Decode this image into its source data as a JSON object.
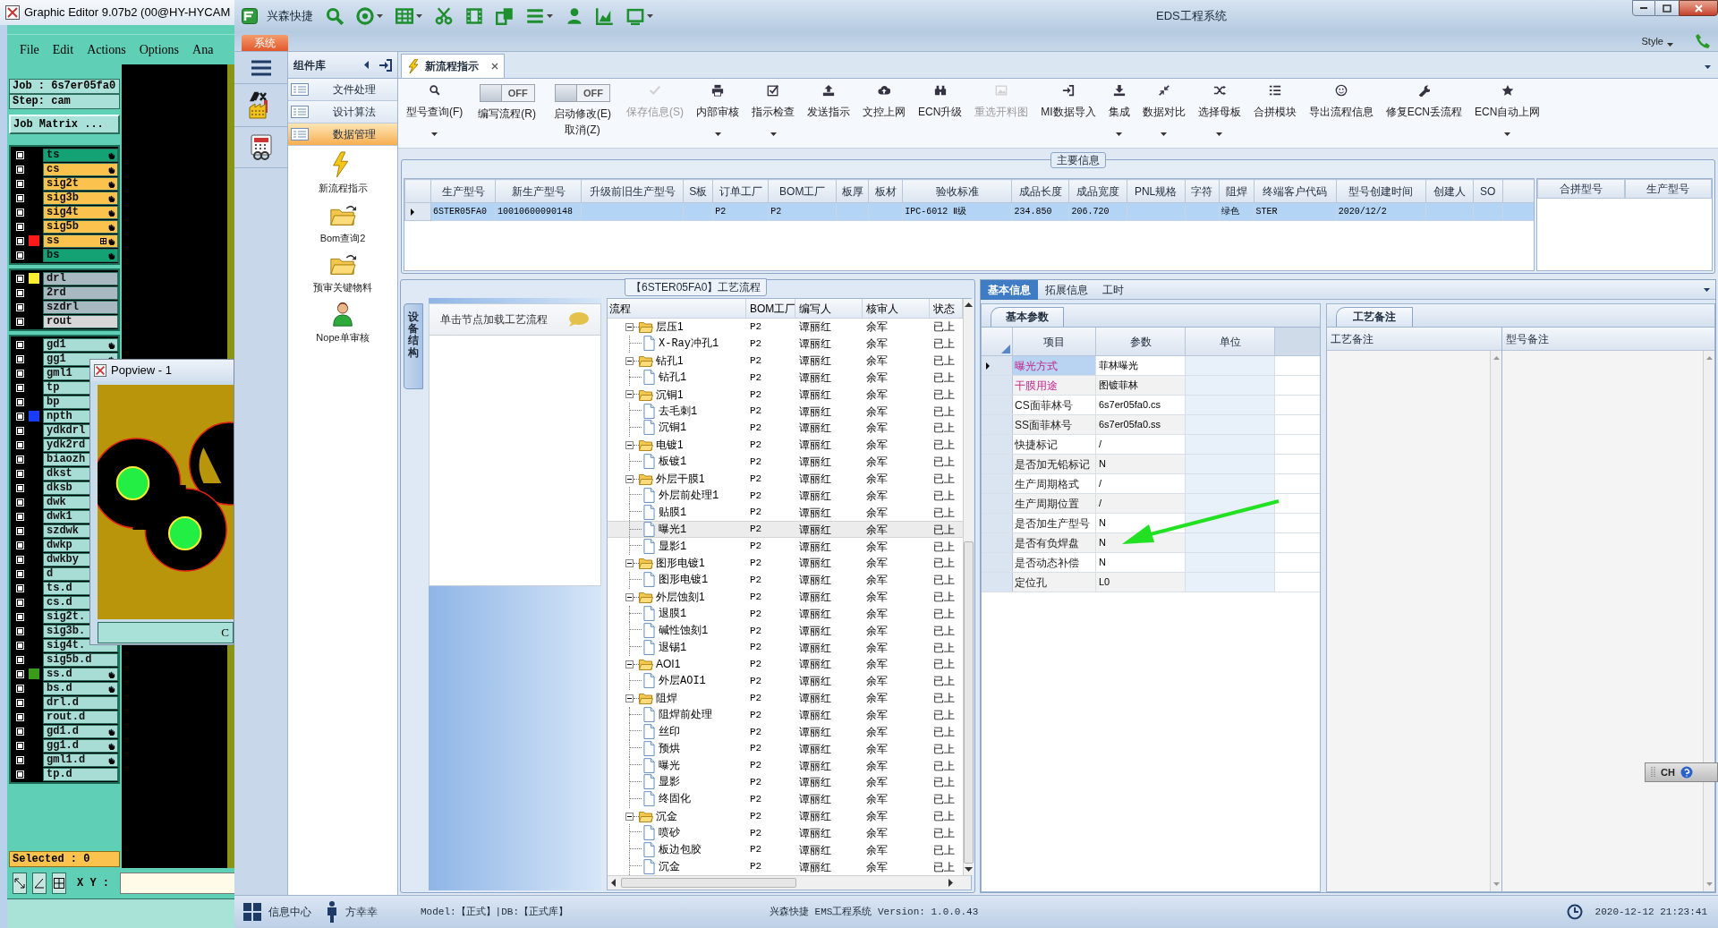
{
  "graphic_editor": {
    "title": "Graphic Editor 9.07b2 (00@HY-HYCAM",
    "menu": [
      "File",
      "Edit",
      "Actions",
      "Options",
      "Ana"
    ],
    "job": "Job : 6s7er05fa0",
    "step": "Step: cam",
    "job_matrix_button": "Job Matrix ...",
    "layer_groups": [
      {
        "layers": [
          {
            "name": "ts",
            "kind": "mask",
            "checked": false,
            "hand": true
          },
          {
            "name": "cs",
            "kind": "signal",
            "checked": false,
            "hand": true
          },
          {
            "name": "sig2t",
            "kind": "signal",
            "checked": false,
            "hand": true
          },
          {
            "name": "sig3b",
            "kind": "signal",
            "checked": false,
            "hand": true
          },
          {
            "name": "sig4t",
            "kind": "signal",
            "checked": false,
            "hand": true
          },
          {
            "name": "sig5b",
            "kind": "signal",
            "checked": false,
            "hand": true
          },
          {
            "name": "ss",
            "kind": "signal",
            "checked": false,
            "hand": true,
            "color": "#ff1a1a",
            "extra_mark": true
          },
          {
            "name": "bs",
            "kind": "mask",
            "checked": false,
            "hand": true
          }
        ]
      },
      {
        "layers": [
          {
            "name": "drl",
            "kind": "drill",
            "checked": false,
            "hand": false,
            "color": "#ffee33"
          },
          {
            "name": "2rd",
            "kind": "drill",
            "checked": false,
            "hand": false
          },
          {
            "name": "szdrl",
            "kind": "drill",
            "checked": false,
            "hand": false
          },
          {
            "name": "rout",
            "kind": "rout",
            "checked": false,
            "hand": false
          }
        ]
      },
      {
        "layers": [
          {
            "name": "gd1",
            "kind": "misc",
            "checked": false,
            "hand": true
          },
          {
            "name": "gg1",
            "kind": "misc",
            "checked": false,
            "hand": true
          },
          {
            "name": "gml1",
            "kind": "misc",
            "checked": false,
            "hand": false
          },
          {
            "name": "tp",
            "kind": "misc",
            "checked": false,
            "hand": false
          },
          {
            "name": "bp",
            "kind": "misc",
            "checked": false,
            "hand": false
          },
          {
            "name": "npth",
            "kind": "misc",
            "checked": false,
            "hand": false,
            "color": "#1a3cff"
          },
          {
            "name": "ydkdrl",
            "kind": "misc",
            "checked": false,
            "hand": false
          },
          {
            "name": "ydk2rd",
            "kind": "misc",
            "checked": false,
            "hand": false
          },
          {
            "name": "biaozh",
            "kind": "misc",
            "checked": false,
            "hand": false
          },
          {
            "name": "dkst",
            "kind": "misc",
            "checked": false,
            "hand": false
          },
          {
            "name": "dksb",
            "kind": "misc",
            "checked": false,
            "hand": false
          },
          {
            "name": "dwk",
            "kind": "misc",
            "checked": false,
            "hand": false
          },
          {
            "name": "dwk1",
            "kind": "misc",
            "checked": false,
            "hand": false
          },
          {
            "name": "szdwk",
            "kind": "misc",
            "checked": false,
            "hand": false
          },
          {
            "name": "dwkp",
            "kind": "misc",
            "checked": false,
            "hand": false
          },
          {
            "name": "dwkby",
            "kind": "misc",
            "checked": false,
            "hand": false
          },
          {
            "name": "d",
            "kind": "misc",
            "checked": false,
            "hand": false
          },
          {
            "name": "ts.d",
            "kind": "misc",
            "checked": false,
            "hand": false
          },
          {
            "name": "cs.d",
            "kind": "misc",
            "checked": false,
            "hand": false
          },
          {
            "name": "sig2t.",
            "kind": "misc",
            "checked": false,
            "hand": false
          },
          {
            "name": "sig3b.",
            "kind": "misc",
            "checked": false,
            "hand": false
          },
          {
            "name": "sig4t.",
            "kind": "misc",
            "checked": false,
            "hand": false
          },
          {
            "name": "sig5b.d",
            "kind": "misc",
            "checked": false,
            "hand": false
          },
          {
            "name": "ss.d",
            "kind": "misc",
            "checked": false,
            "hand": true,
            "color": "#3a9a1a"
          },
          {
            "name": "bs.d",
            "kind": "misc",
            "checked": false,
            "hand": true
          },
          {
            "name": "drl.d",
            "kind": "misc",
            "checked": false,
            "hand": false
          },
          {
            "name": "rout.d",
            "kind": "misc",
            "checked": false,
            "hand": false
          },
          {
            "name": "gd1.d",
            "kind": "misc",
            "checked": false,
            "hand": true
          },
          {
            "name": "gg1.d",
            "kind": "misc",
            "checked": false,
            "hand": true
          },
          {
            "name": "gml1.d",
            "kind": "misc",
            "checked": false,
            "hand": true
          },
          {
            "name": "tp.d",
            "kind": "misc",
            "checked": false,
            "hand": false
          }
        ]
      }
    ],
    "selected_count": "Selected : 0",
    "xy_label": "X Y :"
  },
  "popview": {
    "title": "Popview - 1",
    "button": "C"
  },
  "eds": {
    "title": "EDS工程系统",
    "app_name": "兴森快捷",
    "system_tab": "系统",
    "style_menu": "Style",
    "component_library": {
      "title": "组件库",
      "categories": [
        {
          "label": "文件处理",
          "selected": false
        },
        {
          "label": "设计算法",
          "selected": false
        },
        {
          "label": "数据管理",
          "selected": true
        }
      ],
      "tools": [
        "新流程指示",
        "Bom查询2",
        "预审关键物料",
        "Nope单审核"
      ]
    },
    "document_tabs": [
      {
        "label": "新流程指示",
        "selected": true
      }
    ],
    "toolbar": [
      {
        "kind": "button",
        "label": "型号查询(F)",
        "has_menu": true,
        "disabled": false
      },
      {
        "kind": "toggle",
        "label": "编写流程(R)",
        "toggle": "OFF",
        "on": false
      },
      {
        "kind": "toggle",
        "label": "启动修改(E)",
        "sub_label": "取消(Z)",
        "toggle": "OFF",
        "on": false
      },
      {
        "kind": "button",
        "label": "保存信息(S)",
        "has_menu": false,
        "disabled": true
      },
      {
        "kind": "button",
        "label": "内部审核",
        "has_menu": true,
        "disabled": false
      },
      {
        "kind": "button",
        "label": "指示检查",
        "has_menu": true,
        "disabled": false
      },
      {
        "kind": "button",
        "label": "发送指示",
        "has_menu": false,
        "disabled": false
      },
      {
        "kind": "button",
        "label": "文控上网",
        "has_menu": false,
        "disabled": false
      },
      {
        "kind": "button",
        "label": "ECN升级",
        "has_menu": false,
        "disabled": false
      },
      {
        "kind": "button",
        "label": "重选开料图",
        "has_menu": false,
        "disabled": true
      },
      {
        "kind": "button",
        "label": "MI数据导入",
        "has_menu": false,
        "disabled": false
      },
      {
        "kind": "button",
        "label": "集成",
        "has_menu": true,
        "disabled": false
      },
      {
        "kind": "button",
        "label": "数据对比",
        "has_menu": true,
        "disabled": false
      },
      {
        "kind": "button",
        "label": "选择母板",
        "has_menu": true,
        "disabled": false
      },
      {
        "kind": "button",
        "label": "合拼模块",
        "has_menu": false,
        "disabled": false
      },
      {
        "kind": "button",
        "label": "导出流程信息",
        "has_menu": false,
        "disabled": false
      },
      {
        "kind": "button",
        "label": "修复ECN丢流程",
        "has_menu": false,
        "disabled": false
      },
      {
        "kind": "button",
        "label": "ECN自动上网",
        "has_menu": true,
        "disabled": false
      }
    ],
    "main_info": {
      "title": "主要信息",
      "columns": [
        "生产型号",
        "新生产型号",
        "升级前旧生产型号",
        "S板",
        "订单工厂",
        "BOM工厂",
        "板厚",
        "板材",
        "验收标准",
        "成品长度",
        "成品宽度",
        "PNL规格",
        "字符",
        "阻焊",
        "终端客户代码",
        "型号创建时间",
        "创建人",
        "SO"
      ],
      "rows": [
        {
          "selected": true,
          "cells": [
            "6STER05FA0",
            "10010600090148",
            null,
            null,
            "P2",
            "P2",
            null,
            null,
            "IPC-6012 Ⅱ级",
            "234.850",
            "206.720",
            null,
            null,
            "绿色",
            "STER",
            "2020/12/2",
            null,
            null
          ]
        }
      ],
      "side_columns": [
        "合拼型号",
        "生产型号"
      ]
    },
    "process_flow": {
      "title": "【6STER05FA0】工艺流程",
      "side_tab": "设备结构",
      "hint": "单击节点加载工艺流程",
      "columns": [
        "流程",
        "BOM工厂",
        "编写人",
        "核审人",
        "状态"
      ],
      "nodes": [
        {
          "name": "层压1",
          "bom_factory": "P2",
          "author": "谭丽红",
          "reviewer": "余军",
          "status": "已上",
          "expanded": true,
          "selected": false,
          "children": [
            {
              "name": "X-Ray冲孔1",
              "bom_factory": "P2",
              "author": "谭丽红",
              "reviewer": "余军",
              "status": "已上",
              "selected": false
            }
          ]
        },
        {
          "name": "钻孔1",
          "bom_factory": "P2",
          "author": "谭丽红",
          "reviewer": "余军",
          "status": "已上",
          "expanded": true,
          "selected": false,
          "children": [
            {
              "name": "钻孔1",
              "bom_factory": "P2",
              "author": "谭丽红",
              "reviewer": "余军",
              "status": "已上",
              "selected": false
            }
          ]
        },
        {
          "name": "沉铜1",
          "bom_factory": "P2",
          "author": "谭丽红",
          "reviewer": "余军",
          "status": "已上",
          "expanded": true,
          "selected": false,
          "children": [
            {
              "name": "去毛刺1",
              "bom_factory": "P2",
              "author": "谭丽红",
              "reviewer": "余军",
              "status": "已上",
              "selected": false
            },
            {
              "name": "沉铜1",
              "bom_factory": "P2",
              "author": "谭丽红",
              "reviewer": "余军",
              "status": "已上",
              "selected": false
            }
          ]
        },
        {
          "name": "电镀1",
          "bom_factory": "P2",
          "author": "谭丽红",
          "reviewer": "余军",
          "status": "已上",
          "expanded": true,
          "selected": false,
          "children": [
            {
              "name": "板镀1",
              "bom_factory": "P2",
              "author": "谭丽红",
              "reviewer": "余军",
              "status": "已上",
              "selected": false
            }
          ]
        },
        {
          "name": "外层干膜1",
          "bom_factory": "P2",
          "author": "谭丽红",
          "reviewer": "余军",
          "status": "已上",
          "expanded": true,
          "selected": false,
          "children": [
            {
              "name": "外层前处理1",
              "bom_factory": "P2",
              "author": "谭丽红",
              "reviewer": "余军",
              "status": "已上",
              "selected": false
            },
            {
              "name": "贴膜1",
              "bom_factory": "P2",
              "author": "谭丽红",
              "reviewer": "余军",
              "status": "已上",
              "selected": false
            },
            {
              "name": "曝光1",
              "bom_factory": "P2",
              "author": "谭丽红",
              "reviewer": "余军",
              "status": "已上",
              "selected": true
            },
            {
              "name": "显影1",
              "bom_factory": "P2",
              "author": "谭丽红",
              "reviewer": "余军",
              "status": "已上",
              "selected": false
            }
          ]
        },
        {
          "name": "图形电镀1",
          "bom_factory": "P2",
          "author": "谭丽红",
          "reviewer": "余军",
          "status": "已上",
          "expanded": true,
          "selected": false,
          "children": [
            {
              "name": "图形电镀1",
              "bom_factory": "P2",
              "author": "谭丽红",
              "reviewer": "余军",
              "status": "已上",
              "selected": false
            }
          ]
        },
        {
          "name": "外层蚀刻1",
          "bom_factory": "P2",
          "author": "谭丽红",
          "reviewer": "余军",
          "status": "已上",
          "expanded": true,
          "selected": false,
          "children": [
            {
              "name": "退膜1",
              "bom_factory": "P2",
              "author": "谭丽红",
              "reviewer": "余军",
              "status": "已上",
              "selected": false
            },
            {
              "name": "碱性蚀刻1",
              "bom_factory": "P2",
              "author": "谭丽红",
              "reviewer": "余军",
              "status": "已上",
              "selected": false
            },
            {
              "name": "退锡1",
              "bom_factory": "P2",
              "author": "谭丽红",
              "reviewer": "余军",
              "status": "已上",
              "selected": false
            }
          ]
        },
        {
          "name": "AOI1",
          "bom_factory": "P2",
          "author": "谭丽红",
          "reviewer": "余军",
          "status": "已上",
          "expanded": true,
          "selected": false,
          "children": [
            {
              "name": "外层AOI1",
              "bom_factory": "P2",
              "author": "谭丽红",
              "reviewer": "余军",
              "status": "已上",
              "selected": false
            }
          ]
        },
        {
          "name": "阻焊",
          "bom_factory": "P2",
          "author": "谭丽红",
          "reviewer": "余军",
          "status": "已上",
          "expanded": true,
          "selected": false,
          "children": [
            {
              "name": "阻焊前处理",
              "bom_factory": "P2",
              "author": "谭丽红",
              "reviewer": "余军",
              "status": "已上",
              "selected": false
            },
            {
              "name": "丝印",
              "bom_factory": "P2",
              "author": "谭丽红",
              "reviewer": "余军",
              "status": "已上",
              "selected": false
            },
            {
              "name": "预烘",
              "bom_factory": "P2",
              "author": "谭丽红",
              "reviewer": "余军",
              "status": "已上",
              "selected": false
            },
            {
              "name": "曝光",
              "bom_factory": "P2",
              "author": "谭丽红",
              "reviewer": "余军",
              "status": "已上",
              "selected": false
            },
            {
              "name": "显影",
              "bom_factory": "P2",
              "author": "谭丽红",
              "reviewer": "余军",
              "status": "已上",
              "selected": false
            },
            {
              "name": "终固化",
              "bom_factory": "P2",
              "author": "谭丽红",
              "reviewer": "余军",
              "status": "已上",
              "selected": false
            }
          ]
        },
        {
          "name": "沉金",
          "bom_factory": "P2",
          "author": "谭丽红",
          "reviewer": "余军",
          "status": "已上",
          "expanded": true,
          "selected": false,
          "children": [
            {
              "name": "喷砂",
              "bom_factory": "P2",
              "author": "谭丽红",
              "reviewer": "余军",
              "status": "已上",
              "selected": false
            },
            {
              "name": "板边包胶",
              "bom_factory": "P2",
              "author": "谭丽红",
              "reviewer": "余军",
              "status": "已上",
              "selected": false
            },
            {
              "name": "沉金",
              "bom_factory": "P2",
              "author": "谭丽红",
              "reviewer": "余军",
              "status": "已上",
              "selected": false
            }
          ]
        }
      ]
    },
    "details": {
      "tabs": [
        {
          "label": "基本信息",
          "selected": true
        },
        {
          "label": "拓展信息",
          "selected": false
        },
        {
          "label": "工时",
          "selected": false
        }
      ],
      "params_tab": "基本参数",
      "params_columns": [
        "项目",
        "参数",
        "单位"
      ],
      "params": [
        {
          "item": "曝光方式",
          "value": "菲林曝光",
          "highlighted": true,
          "current": true
        },
        {
          "item": "干膜用途",
          "value": "图镀菲林",
          "highlighted": true,
          "current": false
        },
        {
          "item": "CS面菲林号",
          "value": "6s7er05fa0.cs",
          "highlighted": false,
          "current": false
        },
        {
          "item": "SS面菲林号",
          "value": "6s7er05fa0.ss",
          "highlighted": false,
          "current": false
        },
        {
          "item": "快捷标记",
          "value": "/",
          "highlighted": false,
          "current": false
        },
        {
          "item": "是否加无铅标记",
          "value": "N",
          "highlighted": false,
          "current": false
        },
        {
          "item": "生产周期格式",
          "value": "/",
          "highlighted": false,
          "current": false
        },
        {
          "item": "生产周期位置",
          "value": "/",
          "highlighted": false,
          "current": false
        },
        {
          "item": "是否加生产型号",
          "value": "N",
          "highlighted": false,
          "current": false
        },
        {
          "item": "是否有负焊盘",
          "value": "N",
          "highlighted": false,
          "current": false
        },
        {
          "item": "是否动态补偿",
          "value": "N",
          "highlighted": false,
          "current": false
        },
        {
          "item": "定位孔",
          "value": "L0",
          "highlighted": false,
          "current": false
        }
      ],
      "notes_tab": "工艺备注",
      "notes_columns": [
        "工艺备注",
        "型号备注"
      ]
    },
    "ime_indicator": "CH",
    "status_bar": {
      "message_center": "信息中心",
      "user": "方幸幸",
      "environment": "Model:【正式】|DB:【正式库】",
      "version": "兴森快捷 EMS工程系统 Version: 1.0.0.43",
      "datetime": "2020-12-12 21:23:41"
    }
  }
}
